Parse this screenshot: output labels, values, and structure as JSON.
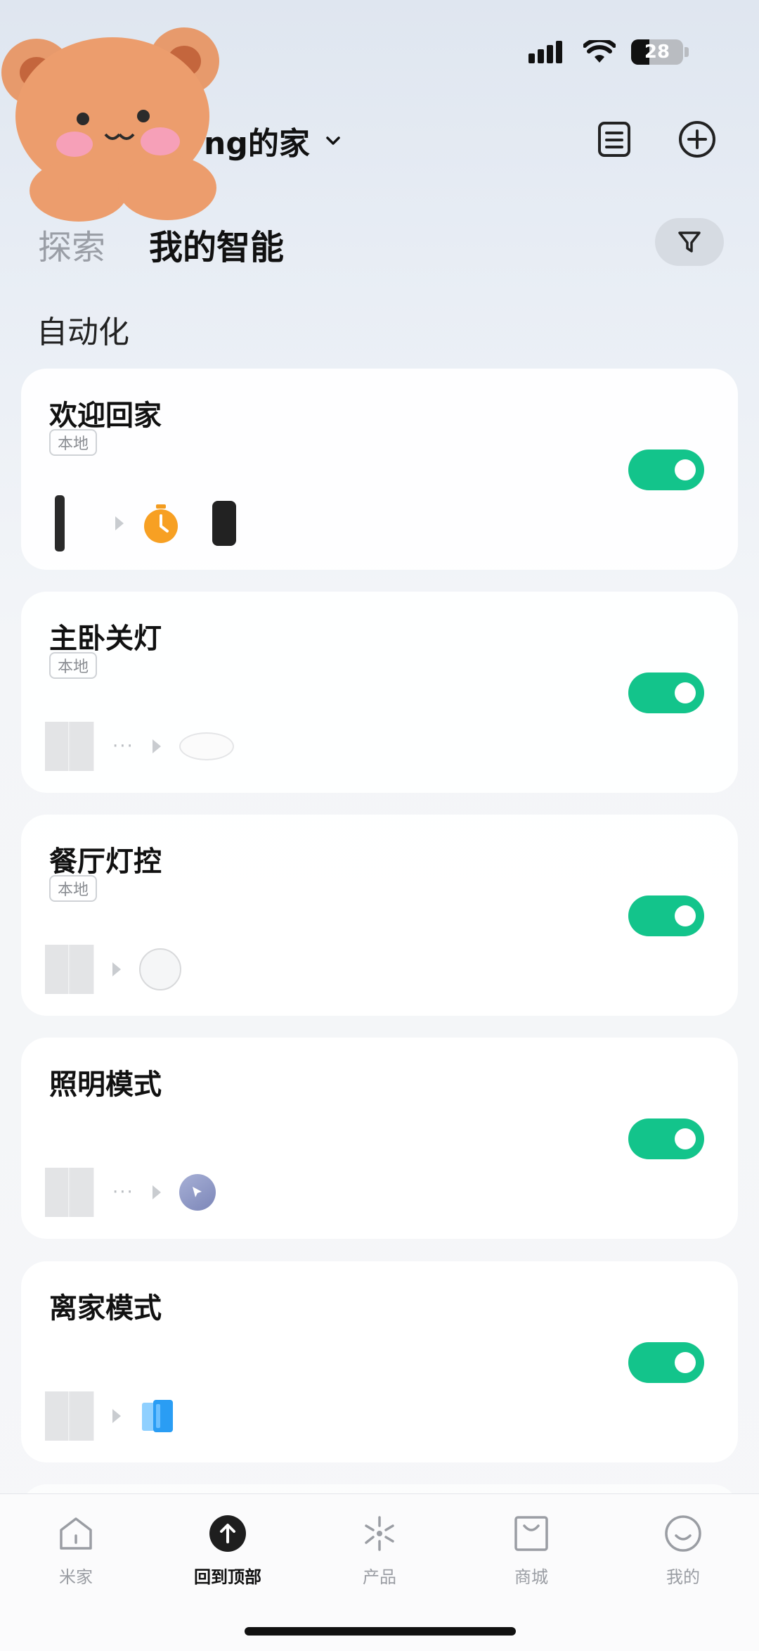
{
  "status_bar": {
    "time": "",
    "battery": "28"
  },
  "header": {
    "home_title": "ng的家"
  },
  "tabs": [
    {
      "label": "探索",
      "active": false
    },
    {
      "label": "我的智能",
      "active": true
    }
  ],
  "section": {
    "title": "自动化"
  },
  "automations": [
    {
      "title": "欢迎回家",
      "tag": "本地",
      "enabled": true
    },
    {
      "title": "主卧关灯",
      "tag": "本地",
      "enabled": true
    },
    {
      "title": "餐厅灯控",
      "tag": "本地",
      "enabled": true
    },
    {
      "title": "照明模式",
      "enabled": true
    },
    {
      "title": "离家模式",
      "enabled": true
    }
  ],
  "bottom_nav": [
    {
      "label": "米家",
      "icon": "home-icon"
    },
    {
      "label": "回到顶部",
      "icon": "arrow-up-icon",
      "active": true
    },
    {
      "label": "产品",
      "icon": "sparkle-icon"
    },
    {
      "label": "商城",
      "icon": "shopping-bag-icon"
    },
    {
      "label": "我的",
      "icon": "smile-icon"
    }
  ],
  "colors": {
    "toggle_on": "#13c48b",
    "accent_dark": "#2a2a2a"
  }
}
